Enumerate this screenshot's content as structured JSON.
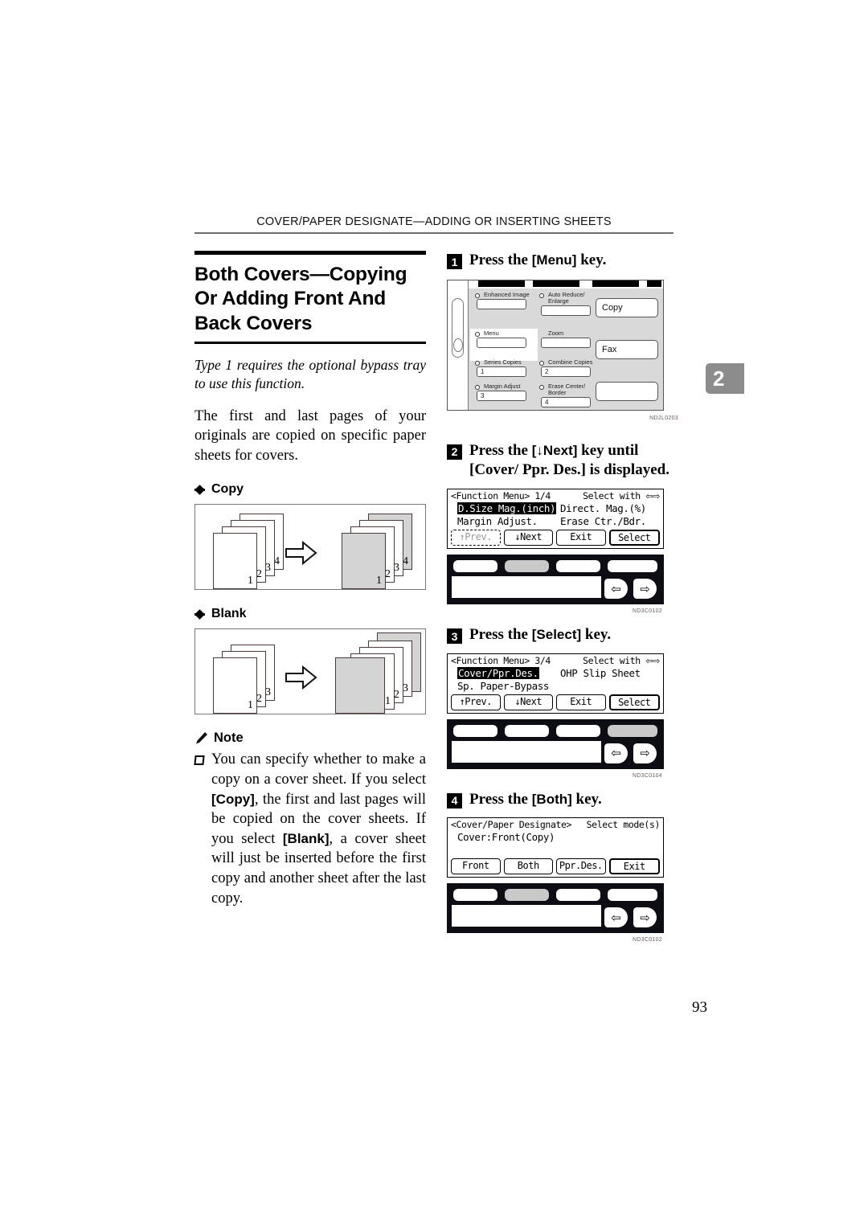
{
  "header": {
    "running_head": "COVER/PAPER DESIGNATE—ADDING OR INSERTING SHEETS",
    "chapter_tab": "2"
  },
  "section": {
    "title": "Both Covers—Copying Or Adding Front And Back Covers",
    "italic_note": "Type 1 requires the optional bypass tray to use this function.",
    "intro": "The first and last pages of your originals are copied on specific paper sheets for covers."
  },
  "illustrations": {
    "copy": {
      "heading": "Copy",
      "input_sheets": [
        "1",
        "2",
        "3",
        "4"
      ],
      "output_sheets": [
        "1",
        "2",
        "3",
        "4"
      ],
      "shaded_output_indices": [
        0,
        3
      ],
      "arrow": "right-arrow-icon"
    },
    "blank": {
      "heading": "Blank",
      "input_sheets": [
        "1",
        "2",
        "3"
      ],
      "output_sheets": [
        "1",
        "2",
        "3"
      ],
      "shaded_output_indices": [
        0,
        4
      ],
      "arrow": "right-arrow-icon"
    }
  },
  "note": {
    "heading": "Note",
    "items": [
      {
        "parts": [
          {
            "t": "You can specify whether to make a copy on a cover sheet. If you select ",
            "b": false
          },
          {
            "t": "[Copy]",
            "b": true
          },
          {
            "t": ", the first and last pages will be copied on the cover sheets. If you select ",
            "b": false
          },
          {
            "t": "[Blank]",
            "b": true
          },
          {
            "t": ", a cover sheet will just be inserted before the first copy and another sheet after the last copy.",
            "b": false
          }
        ]
      }
    ]
  },
  "steps": [
    {
      "num": "1",
      "text_before": "Press the ",
      "key": "[Menu]",
      "text_after": " key.",
      "figure": "control-panel",
      "figure_code": "ND2L0203"
    },
    {
      "num": "2",
      "text_before": "Press the ",
      "key": "[↓Next]",
      "text_after": " key until [Cover/ Ppr. Des.] is displayed.",
      "figure": "lcd-function-menu-1-4",
      "figure_code": "ND3C0102"
    },
    {
      "num": "3",
      "text_before": "Press the ",
      "key": "[Select]",
      "text_after": " key.",
      "figure": "lcd-function-menu-3-4",
      "figure_code": "ND3C0104"
    },
    {
      "num": "4",
      "text_before": "Press the ",
      "key": "[Both]",
      "text_after": " key.",
      "figure": "lcd-cover-paper-designate",
      "figure_code": "ND3C0102"
    }
  ],
  "control_panel": {
    "keys": [
      {
        "label": "Enhanced Image",
        "button": ""
      },
      {
        "label": "Auto Reduce/ Enlarge",
        "button": ""
      },
      {
        "label": "Menu",
        "button": "",
        "highlight": true
      },
      {
        "label": "Zoom",
        "button": "",
        "no_led": true
      },
      {
        "label": "Series Copies",
        "button": "1"
      },
      {
        "label": "Combine Copies",
        "button": "2"
      },
      {
        "label": "Margin Adjust",
        "button": "3"
      },
      {
        "label": "Erase Center/ Border",
        "button": "4"
      }
    ],
    "mode_buttons": [
      "Copy",
      "Fax",
      ""
    ],
    "code": "ND2L0203"
  },
  "lcd_screens": [
    {
      "name": "function-menu-1-4",
      "title": "<Function Menu> 1/4",
      "hint": "Select with",
      "hint_arrows": "⇦⇨",
      "options": [
        {
          "label": "D.Size Mag.(inch)",
          "selected": true
        },
        {
          "label": "Direct. Mag.(%)",
          "selected": false
        },
        {
          "label": "Margin Adjust.",
          "selected": false
        },
        {
          "label": "Erase Ctr./Bdr.",
          "selected": false
        }
      ],
      "buttons": [
        {
          "label": "↑Prev.",
          "state": "disabled"
        },
        {
          "label": "↓Next",
          "state": "normal"
        },
        {
          "label": "Exit",
          "state": "normal"
        },
        {
          "label": "Select",
          "state": "emphasis"
        }
      ],
      "softkey_highlight_index": 1,
      "code": "ND3C0102"
    },
    {
      "name": "function-menu-3-4",
      "title": "<Function Menu> 3/4",
      "hint": "Select with",
      "hint_arrows": "⇦⇨",
      "options": [
        {
          "label": "Cover/Ppr.Des.",
          "selected": true
        },
        {
          "label": "OHP Slip Sheet",
          "selected": false
        },
        {
          "label": "Sp. Paper-Bypass",
          "selected": false
        },
        {
          "label": "",
          "selected": false
        }
      ],
      "buttons": [
        {
          "label": "↑Prev.",
          "state": "normal"
        },
        {
          "label": "↓Next",
          "state": "normal"
        },
        {
          "label": "Exit",
          "state": "normal"
        },
        {
          "label": "Select",
          "state": "emphasis"
        }
      ],
      "softkey_highlight_index": 3,
      "code": "ND3C0104"
    },
    {
      "name": "cover-paper-designate",
      "title": "<Cover/Paper Designate>",
      "hint": "Select mode(s)",
      "hint_arrows": "",
      "status_line": "Cover:Front(Copy)",
      "buttons": [
        {
          "label": "Front",
          "state": "normal"
        },
        {
          "label": "Both",
          "state": "normal"
        },
        {
          "label": "Ppr.Des.",
          "state": "normal"
        },
        {
          "label": "Exit",
          "state": "emphasis"
        }
      ],
      "softkey_highlight_index": 1,
      "code": "ND3C0102"
    }
  ],
  "nav_keys": {
    "left": "⇦",
    "right": "⇨"
  },
  "footer": {
    "page_number": "93"
  }
}
